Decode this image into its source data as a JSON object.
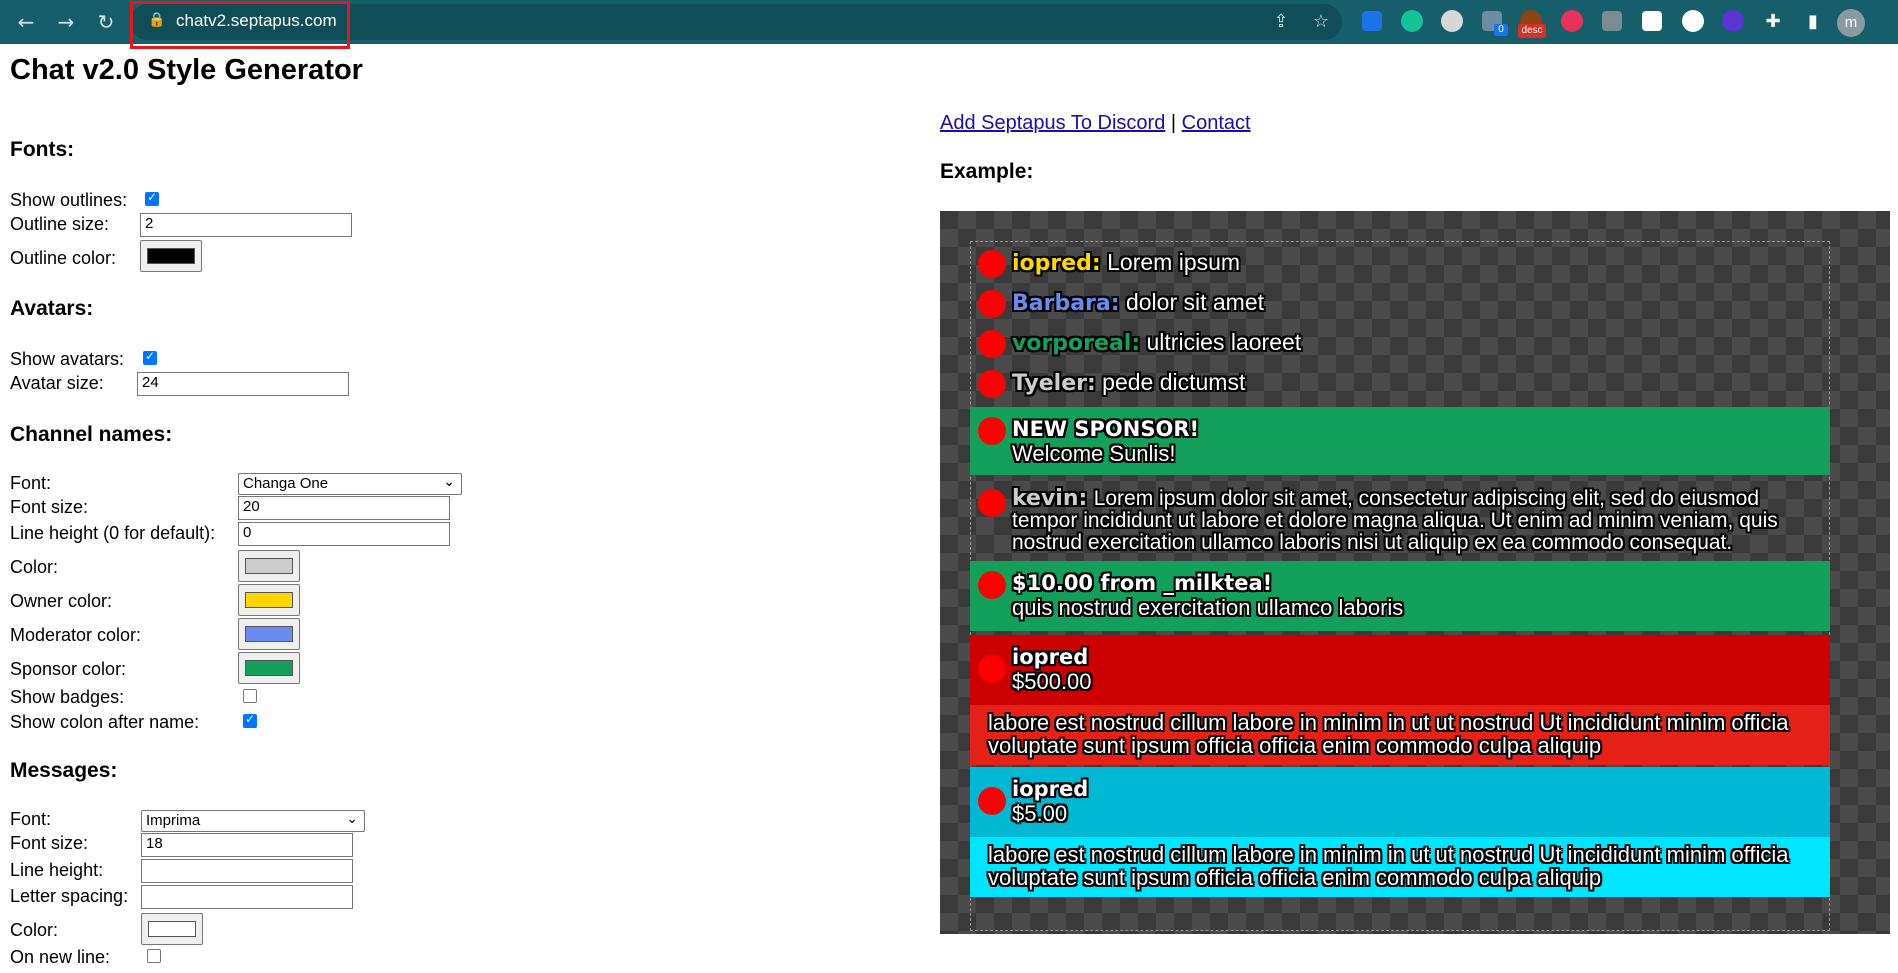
{
  "browser": {
    "url": "chatv2.septapus.com",
    "profile_initial": "m",
    "ext_badge_count": "0",
    "ext_badge_desc": "desc"
  },
  "page": {
    "title": "Chat v2.0 Style Generator"
  },
  "fonts": {
    "heading": "Fonts:",
    "show_outlines_label": "Show outlines:",
    "show_outlines": true,
    "outline_size_label": "Outline size:",
    "outline_size": "2",
    "outline_color_label": "Outline color:",
    "outline_color": "#000000"
  },
  "avatars": {
    "heading": "Avatars:",
    "show_avatars_label": "Show avatars:",
    "show_avatars": true,
    "avatar_size_label": "Avatar size:",
    "avatar_size": "24"
  },
  "channel_names": {
    "heading": "Channel names:",
    "font_label": "Font:",
    "font": "Changa One",
    "font_size_label": "Font size:",
    "font_size": "20",
    "line_height_label": "Line height (0 for default):",
    "line_height": "0",
    "color_label": "Color:",
    "color": "#cccccc",
    "owner_color_label": "Owner color:",
    "owner_color": "#ffd700",
    "moderator_color_label": "Moderator color:",
    "moderator_color": "#6a8cf0",
    "sponsor_color_label": "Sponsor color:",
    "sponsor_color": "#12a05a",
    "show_badges_label": "Show badges:",
    "show_badges": false,
    "show_colon_label": "Show colon after name:",
    "show_colon": true
  },
  "messages": {
    "heading": "Messages:",
    "font_label": "Font:",
    "font": "Imprima",
    "font_size_label": "Font size:",
    "font_size": "18",
    "line_height_label": "Line height:",
    "line_height": "",
    "letter_spacing_label": "Letter spacing:",
    "letter_spacing": "",
    "color_label": "Color:",
    "color": "#ffffff",
    "on_new_line_label": "On new line:",
    "on_new_line": false
  },
  "links": {
    "add_discord": "Add Septapus To Discord",
    "separator": "|",
    "contact": "Contact"
  },
  "example": {
    "heading": "Example:",
    "chat": [
      {
        "name": "iopred:",
        "text": "Lorem ipsum",
        "color": "#ffd700"
      },
      {
        "name": "Barbara:",
        "text": "dolor sit amet",
        "color": "#6a8cf0"
      },
      {
        "name": "vorporeal:",
        "text": "ultricies laoreet",
        "color": "#12a05a"
      },
      {
        "name": "Tyeler:",
        "text": "pede dictumst",
        "color": "#cccccc"
      }
    ],
    "sponsor": {
      "title": "NEW SPONSOR!",
      "text": "Welcome Sunlis!"
    },
    "kevin": {
      "name": "kevin:",
      "text": "Lorem ipsum dolor sit amet, consectetur adipiscing elit, sed do eiusmod tempor incididunt ut labore et dolore magna aliqua. Ut enim ad minim veniam, quis nostrud exercitation ullamco laboris nisi ut aliquip ex ea commodo consequat."
    },
    "donation": {
      "title": "$10.00 from _milktea!",
      "text": "quis nostrud exercitation ullamco laboris"
    },
    "superchat_red": {
      "name": "iopred",
      "amount": "$500.00",
      "text": "labore est nostrud cillum labore in minim in ut ut nostrud Ut incididunt minim officia voluptate sunt ipsum officia officia enim commodo culpa aliquip"
    },
    "superchat_cyan": {
      "name": "iopred",
      "amount": "$5.00",
      "text": "labore est nostrud cillum labore in minim in ut ut nostrud Ut incididunt minim officia voluptate sunt ipsum officia officia enim commodo culpa aliquip"
    }
  }
}
